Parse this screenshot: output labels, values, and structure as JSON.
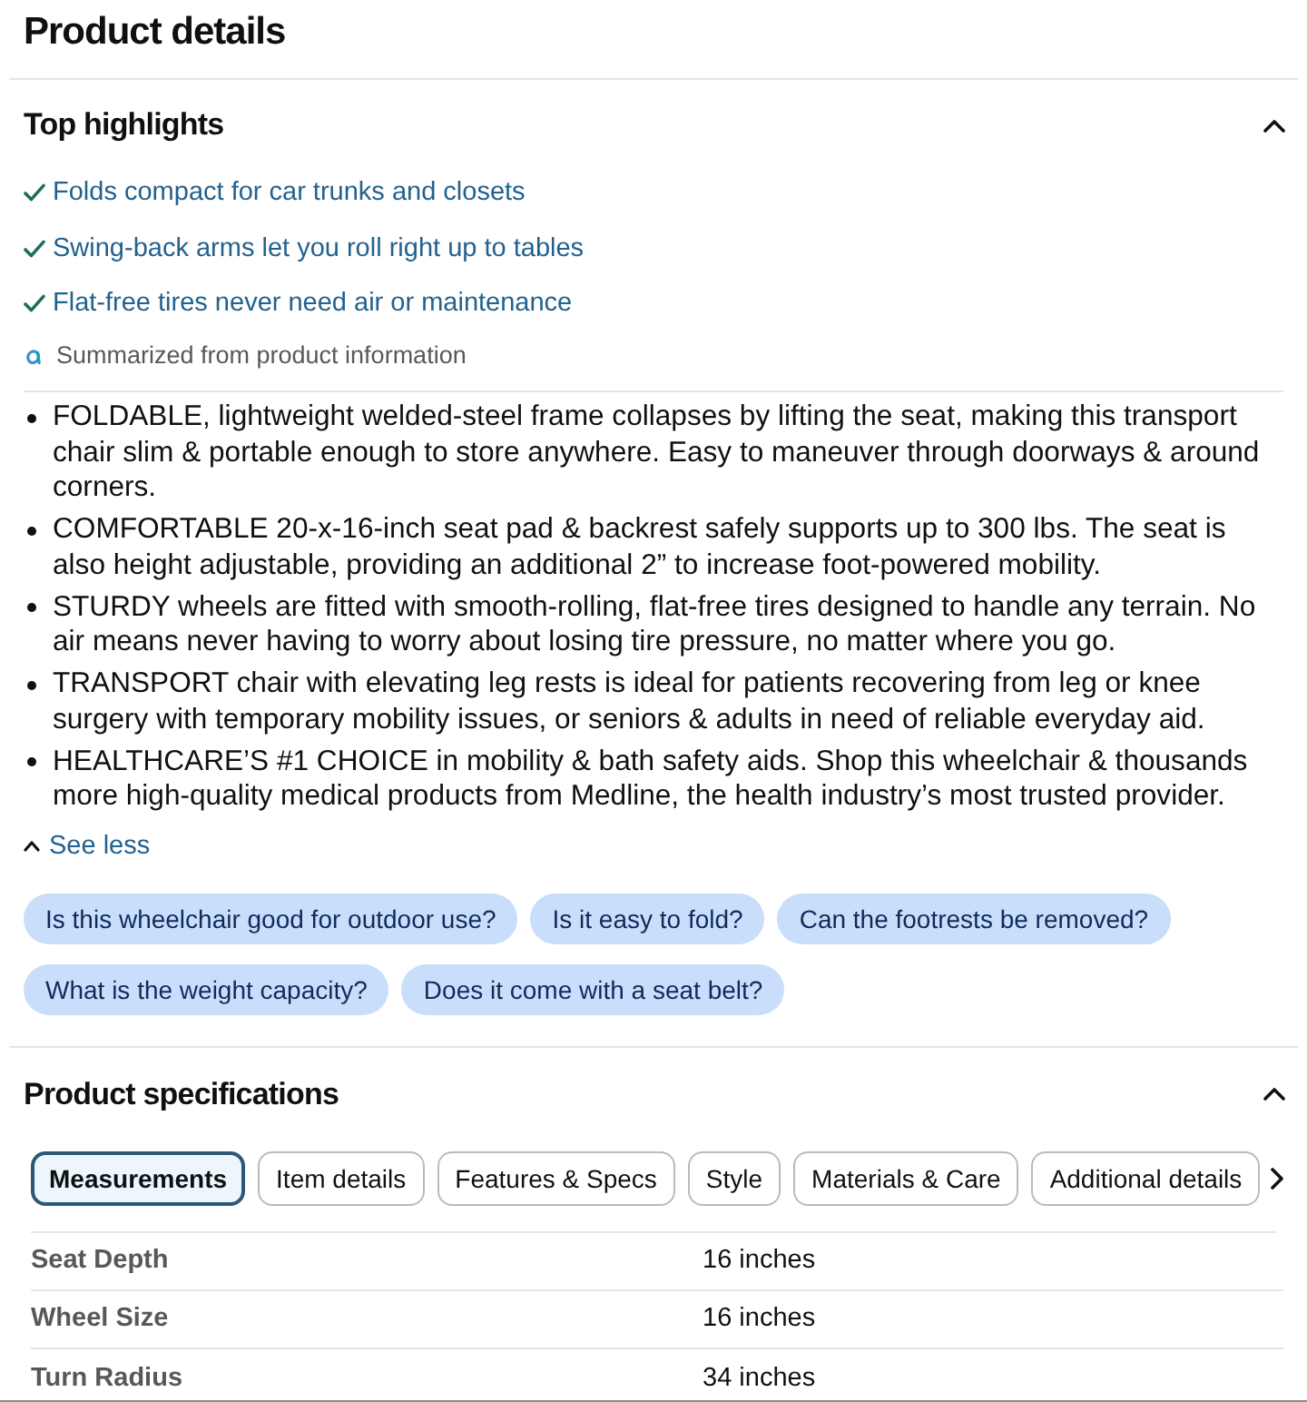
{
  "page_title": "Product details",
  "highlights": {
    "title": "Top highlights",
    "expanded": true,
    "items": [
      "Folds compact for car trunks and closets",
      "Swing-back arms let you roll right up to tables",
      "Flat-free tires never need air or maintenance"
    ],
    "summary_note": "Summarized from product information",
    "bullets": [
      "FOLDABLE, lightweight welded-steel frame collapses by lifting the seat, making this transport chair slim & portable enough to store anywhere. Easy to maneuver through doorways & around corners.",
      "COMFORTABLE 20-x-16-inch seat pad & backrest safely supports up to 300 lbs. The seat is also height adjustable, providing an additional 2” to increase foot-powered mobility.",
      "STURDY wheels are fitted with smooth-rolling, flat-free tires designed to handle any terrain. No air means never having to worry about losing tire pressure, no matter where you go.",
      "TRANSPORT chair with elevating leg rests is ideal for patients recovering from leg or knee surgery with temporary mobility issues, or seniors & adults in need of reliable everyday aid.",
      "HEALTHCARE’S #1 CHOICE in mobility & bath safety aids. Shop this wheelchair & thousands more high-quality medical products from Medline, the health industry’s most trusted provider."
    ],
    "toggle": "See less"
  },
  "questions": [
    "Is this wheelchair good for outdoor use?",
    "Is it easy to fold?",
    "Can the footrests be removed?",
    "What is the weight capacity?",
    "Does it come with a seat belt?"
  ],
  "specifications": {
    "title": "Product specifications",
    "expanded": true,
    "tabs": [
      {
        "label": "Measurements",
        "selected": true
      },
      {
        "label": "Item details",
        "selected": false
      },
      {
        "label": "Features & Specs",
        "selected": false
      },
      {
        "label": "Style",
        "selected": false
      },
      {
        "label": "Materials & Care",
        "selected": false
      },
      {
        "label": "Additional details",
        "selected": false
      }
    ],
    "rows": [
      {
        "label": "Seat Depth",
        "value": "16 inches"
      },
      {
        "label": "Wheel Size",
        "value": "16 inches"
      },
      {
        "label": "Turn Radius",
        "value": "34 inches"
      }
    ]
  }
}
